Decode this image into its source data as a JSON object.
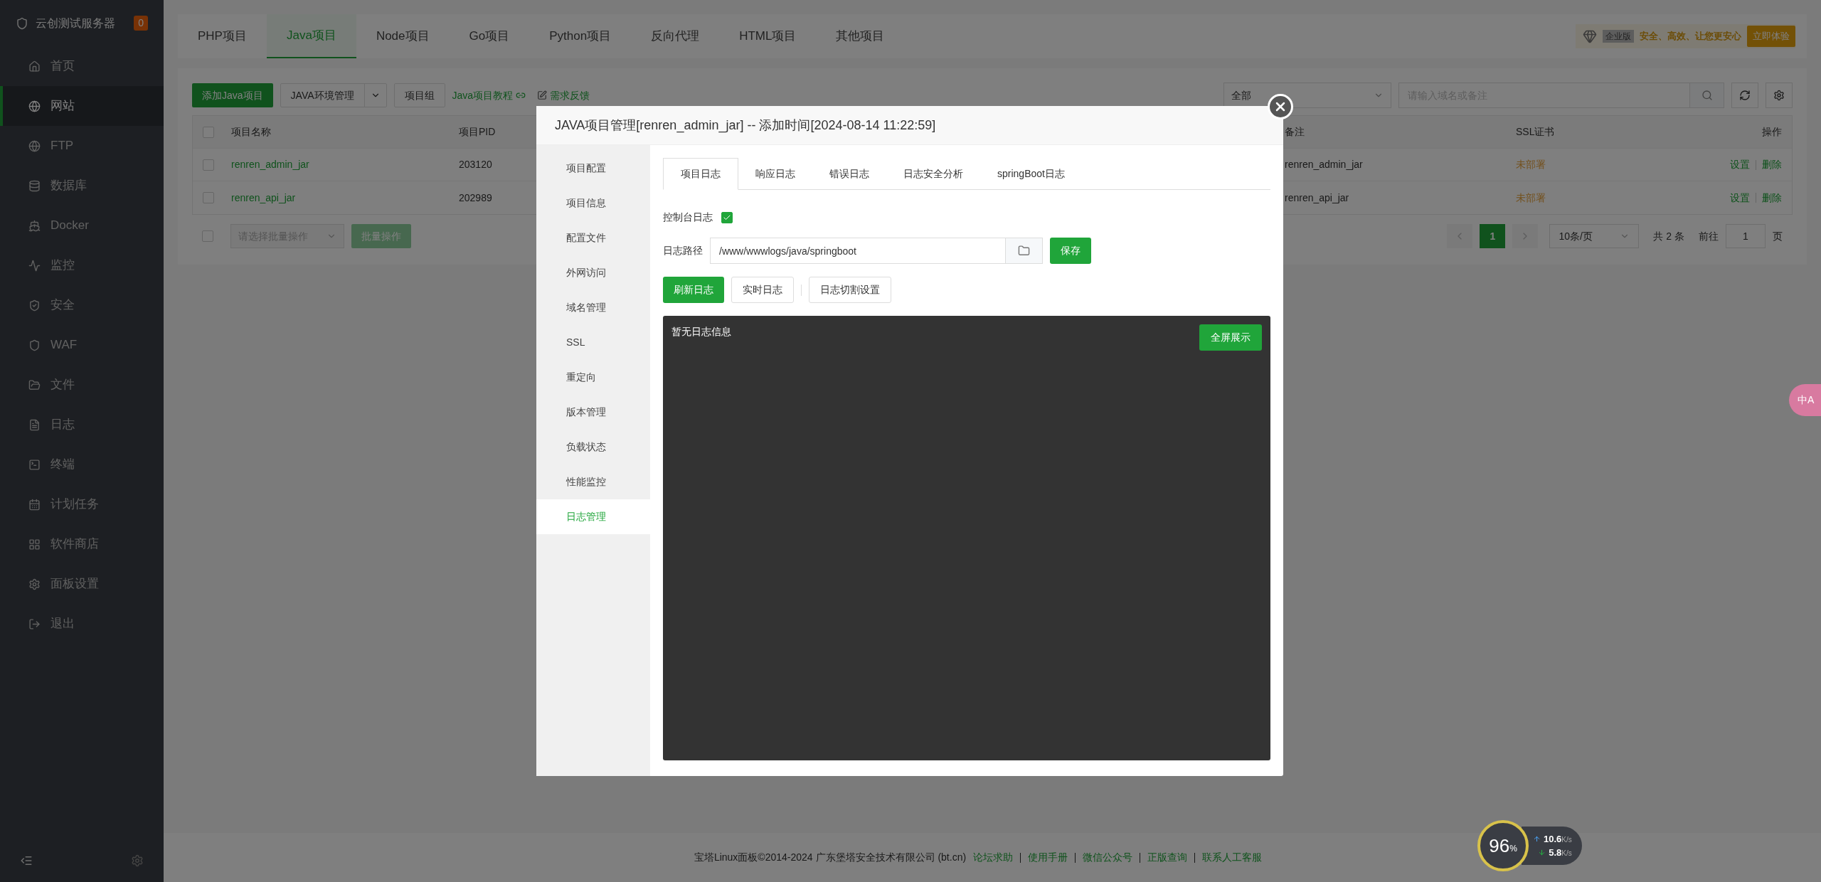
{
  "sidebar": {
    "server_name": "云创测试服务器",
    "badge": "0",
    "items": [
      {
        "label": "首页",
        "selected": false
      },
      {
        "label": "网站",
        "selected": true
      },
      {
        "label": "FTP",
        "selected": false
      },
      {
        "label": "数据库",
        "selected": false
      },
      {
        "label": "Docker",
        "selected": false
      },
      {
        "label": "监控",
        "selected": false
      },
      {
        "label": "安全",
        "selected": false
      },
      {
        "label": "WAF",
        "selected": false
      },
      {
        "label": "文件",
        "selected": false
      },
      {
        "label": "日志",
        "selected": false
      },
      {
        "label": "终端",
        "selected": false
      },
      {
        "label": "计划任务",
        "selected": false
      },
      {
        "label": "软件商店",
        "selected": false
      },
      {
        "label": "面板设置",
        "selected": false
      },
      {
        "label": "退出",
        "selected": false
      }
    ]
  },
  "top_tabs": [
    {
      "label": "PHP项目",
      "selected": false
    },
    {
      "label": "Java项目",
      "selected": true
    },
    {
      "label": "Node项目",
      "selected": false
    },
    {
      "label": "Go项目",
      "selected": false
    },
    {
      "label": "Python项目",
      "selected": false
    },
    {
      "label": "反向代理",
      "selected": false
    },
    {
      "label": "HTML项目",
      "selected": false
    },
    {
      "label": "其他项目",
      "selected": false
    }
  ],
  "promo": {
    "badge": "企业版",
    "slogan": "安全、高效、让您更安心",
    "button": "立即体验"
  },
  "toolbar": {
    "add_button": "添加Java项目",
    "env_button": "JAVA环境管理",
    "group_button": "项目组",
    "tutorial_link": "Java项目教程",
    "feedback_link": "需求反馈",
    "category": "全部",
    "search_placeholder": "请输入域名或备注"
  },
  "table": {
    "select_all": {
      "checked": false
    },
    "columns": [
      "项目名称",
      "项目PID",
      "备注",
      "SSL证书",
      "操作"
    ],
    "rows": [
      {
        "checked": false,
        "name": "renren_admin_jar",
        "pid": "203120",
        "note": "renren_admin_jar",
        "ssl": "未部署",
        "actions": [
          "设置",
          "删除"
        ]
      },
      {
        "checked": false,
        "name": "renren_api_jar",
        "pid": "202989",
        "note": "renren_api_jar",
        "ssl": "未部署",
        "actions": [
          "设置",
          "删除"
        ]
      }
    ]
  },
  "bulk": {
    "checked": false,
    "placeholder": "请选择批量操作",
    "button": "批量操作"
  },
  "pagination": {
    "current": "1",
    "per_page": "10条/页",
    "total": "共 2 条",
    "goto": "前往",
    "page_value": "1",
    "page_suffix": "页"
  },
  "modal": {
    "title": "JAVA项目管理[renren_admin_jar] -- 添加时间[2024-08-14 11:22:59]",
    "nav": [
      {
        "label": "项目配置",
        "selected": false
      },
      {
        "label": "项目信息",
        "selected": false
      },
      {
        "label": "配置文件",
        "selected": false
      },
      {
        "label": "外网访问",
        "selected": false
      },
      {
        "label": "域名管理",
        "selected": false
      },
      {
        "label": "SSL",
        "selected": false
      },
      {
        "label": "重定向",
        "selected": false
      },
      {
        "label": "版本管理",
        "selected": false
      },
      {
        "label": "负载状态",
        "selected": false
      },
      {
        "label": "性能监控",
        "selected": false
      },
      {
        "label": "日志管理",
        "selected": true
      }
    ],
    "tabs": [
      {
        "label": "项目日志",
        "selected": true
      },
      {
        "label": "响应日志",
        "selected": false
      },
      {
        "label": "错误日志",
        "selected": false
      },
      {
        "label": "日志安全分析",
        "selected": false
      },
      {
        "label": "springBoot日志",
        "selected": false
      }
    ],
    "console_log": {
      "label": "控制台日志",
      "checked": true
    },
    "log_path": {
      "label": "日志路径",
      "value": "/www/wwwlogs/java/springboot"
    },
    "save_button": "保存",
    "refresh_button": "刷新日志",
    "realtime_button": "实时日志",
    "rotate_button": "日志切割设置",
    "log_text": "暂无日志信息",
    "fullscreen_button": "全屏展示"
  },
  "footer": {
    "copyright": "宝塔Linux面板©2014-2024 广东堡塔安全技术有限公司 (bt.cn)",
    "links": [
      "论坛求助",
      "使用手册",
      "微信公众号",
      "正版查询",
      "联系人工客服"
    ]
  },
  "monitor": {
    "percent": "96",
    "unit": "%",
    "up": "10.6",
    "down": "5.8",
    "up_unit": "K/s",
    "down_unit": "K/s"
  },
  "translate_badge": {
    "label": "中A"
  }
}
